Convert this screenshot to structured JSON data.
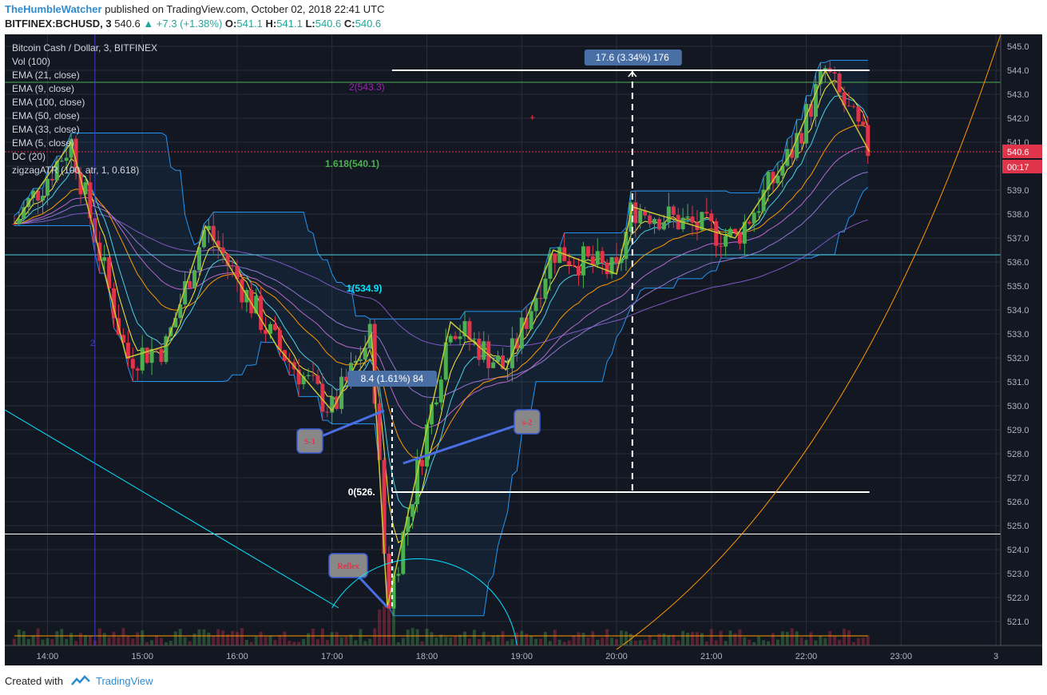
{
  "header": {
    "author": "TheHumbleWatcher",
    "published_text": "published on TradingView.com, October 02, 2018 22:41 UTC",
    "symbol": "BITFINEX:BCHUSD, 3",
    "last": "540.6",
    "change": "▲ +7.3 (+1.38%)",
    "o_label": "O:",
    "o_val": "541.1",
    "h_label": "H:",
    "h_val": "541.1",
    "l_label": "L:",
    "l_val": "540.6",
    "c_label": "C:",
    "c_val": "540.6"
  },
  "legend": [
    "Bitcoin Cash / Dollar, 3, BITFINEX",
    "Vol (100)",
    "EMA (21, close)",
    "EMA (9, close)",
    "EMA (100, close)",
    "EMA (50, close)",
    "EMA (33, close)",
    "EMA (5, close)",
    "DC (20)",
    "zigzagATR (100, atr, 1, 0.618)"
  ],
  "colors": {
    "background": "#131722",
    "grid": "#2a2e39",
    "up": "#4caf50",
    "down": "#e0344a",
    "ema_cyan": "#4dd0e1",
    "ema_yellow": "#ffeb3b",
    "ema_orange": "#ff9800",
    "ema_purple": "#7e57c2",
    "donchian": "#2196f3",
    "zigzag": "#c8c832",
    "fib_green": "#4caf50",
    "fib_purple": "#9c27b0",
    "fib_cyan": "#00e5ff",
    "measure": "#ffffff",
    "label_bg": "#4a6fa5"
  },
  "annotations": {
    "fib_2": "2(543.3)",
    "fib_1618": "1.618(540.1)",
    "fib_1": "1(534.9)",
    "fib_0": "0(526.",
    "measure_top": "17.6 (3.34%) 176",
    "measure_low": "8.4 (1.61%) 84",
    "s1": "S-1",
    "s2": "s-2",
    "reflex": "Reflex",
    "p2": "2",
    "last_price": "540.6",
    "countdown": "00:17"
  },
  "footer": {
    "created_with": "Created with",
    "brand": "TradingView"
  },
  "chart_data": {
    "type": "candlestick",
    "title": "Bitcoin Cash / Dollar, 3, BITFINEX",
    "ylim": [
      520,
      545.5
    ],
    "y_ticks": [
      "521.0",
      "522.0",
      "523.0",
      "524.0",
      "525.0",
      "526.0",
      "527.0",
      "528.0",
      "529.0",
      "530.0",
      "531.0",
      "532.0",
      "533.0",
      "534.0",
      "535.0",
      "536.0",
      "537.0",
      "538.0",
      "539.0",
      "540.0",
      "541.0",
      "542.0",
      "543.0",
      "544.0",
      "545.0"
    ],
    "x_ticks": [
      "14:00",
      "15:00",
      "16:00",
      "17:00",
      "18:00",
      "19:00",
      "20:00",
      "21:00",
      "22:00",
      "23:00",
      "3"
    ],
    "x_tick_hours": [
      14,
      15,
      16,
      17,
      18,
      19,
      20,
      21,
      22,
      23,
      24
    ],
    "time_range_hours": [
      13.55,
      24.05
    ],
    "key_points": [
      {
        "time": "14:15",
        "price": 541.0
      },
      {
        "time": "14:50",
        "price": 532.0
      },
      {
        "time": "15:15",
        "price": 532.5
      },
      {
        "time": "15:40",
        "price": 537.5
      },
      {
        "time": "16:25",
        "price": 532.5
      },
      {
        "time": "17:00",
        "price": 529.8
      },
      {
        "time": "17:25",
        "price": 533.0
      },
      {
        "time": "17:35",
        "price": 521.6
      },
      {
        "time": "18:15",
        "price": 533.5
      },
      {
        "time": "18:50",
        "price": 531.5
      },
      {
        "time": "19:20",
        "price": 536.5
      },
      {
        "time": "20:00",
        "price": 535.5
      },
      {
        "time": "20:10",
        "price": 538.3
      },
      {
        "time": "21:15",
        "price": 537.0
      },
      {
        "time": "21:50",
        "price": 540.5
      },
      {
        "time": "22:12",
        "price": 544.0
      },
      {
        "time": "22:40",
        "price": 540.6
      }
    ],
    "horizontal_levels": [
      {
        "price": 543.5,
        "color": "#4caf50"
      },
      {
        "price": 536.3,
        "color": "#4dd0e1"
      },
      {
        "price": 524.65,
        "color": "#ffffff"
      },
      {
        "price": 540.6,
        "color": "#e0344a"
      }
    ],
    "measure": {
      "top": 544.0,
      "bottom": 526.4,
      "value": 17.6,
      "percent": 3.34,
      "ticks": 176
    }
  }
}
